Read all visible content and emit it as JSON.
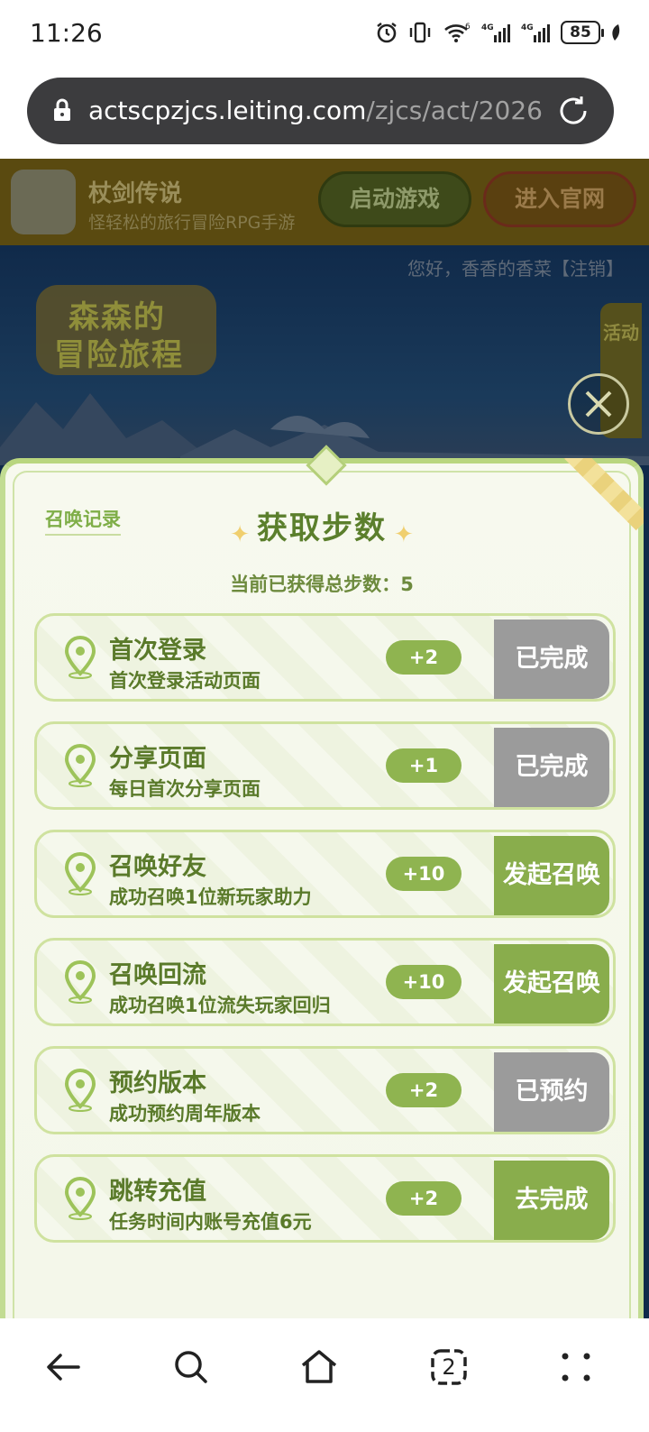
{
  "status_bar": {
    "time": "11:26",
    "battery": "85",
    "network_labels": [
      "6",
      "4G",
      "4G"
    ]
  },
  "browser": {
    "url_host": "actscpzjcs.leiting.com",
    "url_path": "/zjcs/act/2026"
  },
  "banner": {
    "app_name": "杖剑传说",
    "app_subtitle": "怪轻松的旅行冒险RPG手游",
    "start_game": "启动游戏",
    "enter_official": "进入官网"
  },
  "header": {
    "greeting": "您好，香香的香菜【注销】",
    "logo_line1": "森森的",
    "logo_line2": "冒险旅程",
    "side_tab": "活动"
  },
  "modal": {
    "record_link": "召唤记录",
    "title": "获取步数",
    "total_label": "当前已获得总步数：",
    "total_value": "5",
    "tasks": [
      {
        "name": "首次登录",
        "desc": "首次登录活动页面",
        "points": "+2",
        "action": "已完成",
        "state": "done"
      },
      {
        "name": "分享页面",
        "desc": "每日首次分享页面",
        "points": "+1",
        "action": "已完成",
        "state": "done"
      },
      {
        "name": "召唤好友",
        "desc": "成功召唤1位新玩家助力",
        "points": "+10",
        "action": "发起召唤",
        "state": "go"
      },
      {
        "name": "召唤回流",
        "desc": "成功召唤1位流失玩家回归",
        "points": "+10",
        "action": "发起召唤",
        "state": "go"
      },
      {
        "name": "预约版本",
        "desc": "成功预约周年版本",
        "points": "+2",
        "action": "已预约",
        "state": "done"
      },
      {
        "name": "跳转充值",
        "desc": "任务时间内账号充值6元",
        "points": "+2",
        "action": "去完成",
        "state": "go"
      }
    ]
  },
  "nav": {
    "tab_count": "2",
    "icons": [
      "back-icon",
      "search-icon",
      "home-icon",
      "tabs-icon",
      "menu-icon"
    ]
  },
  "colors": {
    "accent_green": "#89ad4c",
    "done_gray": "#9b9b9b",
    "title_green": "#5b7f2c"
  }
}
